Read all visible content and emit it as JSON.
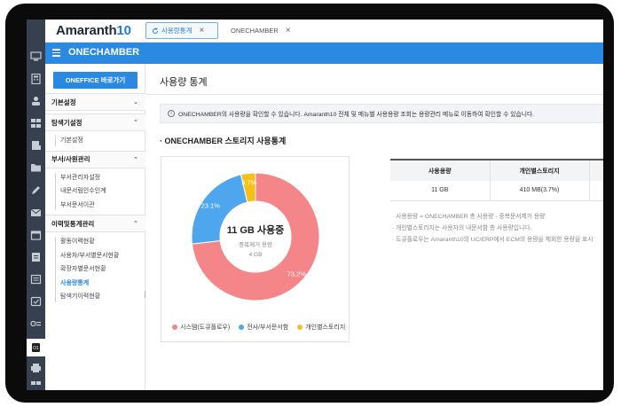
{
  "app": {
    "logo_text": "Amaranth",
    "logo_num": "10",
    "brand_color": "#2a8ae2"
  },
  "tabs": [
    {
      "label": "사용량통계",
      "active": true
    },
    {
      "label": "ONECHAMBER",
      "active": false
    }
  ],
  "header": {
    "title": "ONECHAMBER"
  },
  "sidebar": {
    "oneffice_button": "ONEFFICE 바로가기",
    "sections": [
      {
        "label": "기본설정",
        "items": []
      },
      {
        "label": "탐색기설정",
        "items": [
          "기본설정"
        ]
      },
      {
        "label": "부서/사원관리",
        "items": [
          "부서관리자설정",
          "내문서림인수인계",
          "부서문서이관"
        ]
      },
      {
        "label": "이력및통계관리",
        "items": [
          "활동이력현황",
          "사용자/부서별문서현황",
          "확장자별문서현황",
          "사용량통계",
          "탐색기이력현황"
        ]
      }
    ],
    "active_item": "사용량통계"
  },
  "main": {
    "page_title": "사용량 통계",
    "notice": "ONECHAMBER의 사용량을 확인할 수 있습니다.  Amaranth10 전체 및 메뉴별 사용용량 조회는 용량관리 메뉴로 이동하여 확인할 수 있습니다.",
    "section_title": "· ONECHAMBER 스토리지 사용통계",
    "donut": {
      "center_main": "11 GB 사용중",
      "center_sub1": "중복제거 용량",
      "center_sub2": "4 GB"
    },
    "table": {
      "headers": [
        "사용용량",
        "개인별스토리지",
        ""
      ],
      "row": [
        "11 GB",
        "410 MB(3.7%)",
        ""
      ]
    },
    "notes": [
      "· 사용용량 = ONECHAMBER 총 사용량 - 중복문서제거 용량",
      "· 개인별스토리지는 사용자의 내문서함 총 사용량입니다.",
      "· 도큐플로우는 Amaranth10의 UC/ERP에서 ECM의 용량을 제외한 용량을 표시"
    ]
  },
  "chart_data": {
    "type": "pie",
    "categories": [
      "시스템(도큐플로우)",
      "전사/부서문서함",
      "개인별스토리지"
    ],
    "values": [
      73.2,
      23.1,
      3.7
    ],
    "labels": [
      "73.2%",
      "23.1%",
      "3.7%"
    ],
    "colors": [
      "#f4868a",
      "#4ea6ee",
      "#f5c018"
    ],
    "legend": "bottom"
  }
}
